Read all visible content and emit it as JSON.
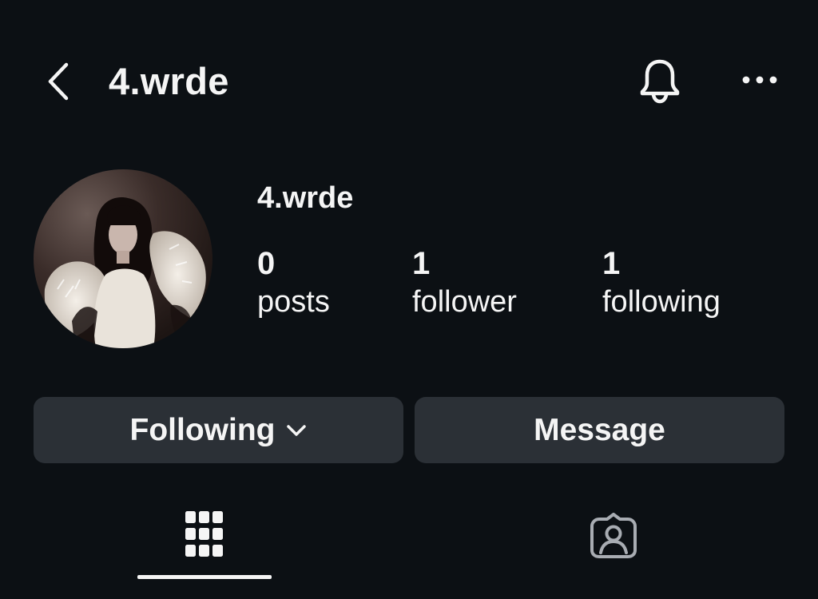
{
  "header": {
    "title": "4.wrde",
    "back_icon": "chevron-left-icon",
    "notifications_icon": "bell-icon",
    "more_icon": "more-horizontal-icon"
  },
  "profile": {
    "name": "4.wrde",
    "avatar": "profile-photo"
  },
  "stats": {
    "posts": {
      "value": "0",
      "label": "posts"
    },
    "followers": {
      "value": "1",
      "label": "follower"
    },
    "following": {
      "value": "1",
      "label": "following"
    }
  },
  "actions": {
    "following_label": "Following",
    "following_icon": "chevron-down-icon",
    "message_label": "Message"
  },
  "tabs": {
    "grid_icon": "grid-icon",
    "tagged_icon": "tagged-user-icon",
    "active": "grid"
  },
  "colors": {
    "background": "#0c1014",
    "text": "#f5f5f5",
    "button": "#2b3036",
    "inactive_icon": "#a8acb2"
  }
}
